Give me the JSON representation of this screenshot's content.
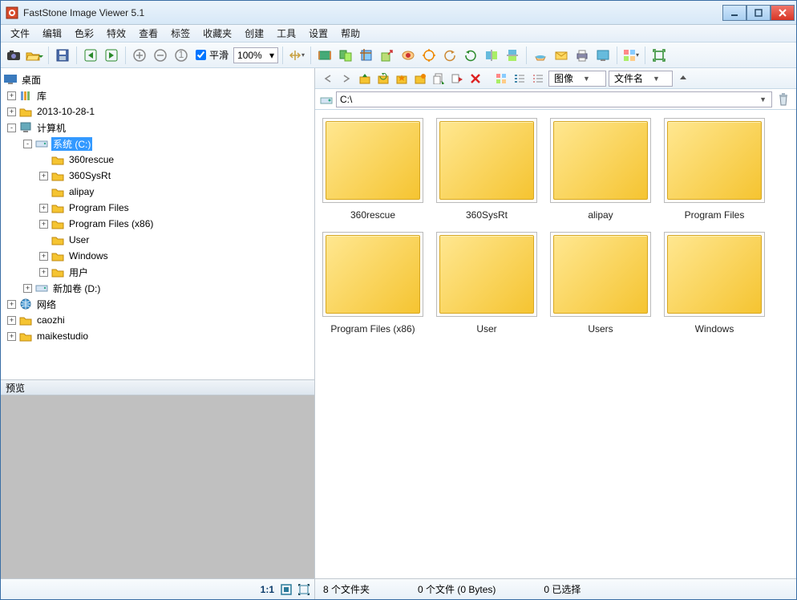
{
  "window": {
    "title": "FastStone Image Viewer 5.1"
  },
  "menu": {
    "items": [
      "文件",
      "编辑",
      "色彩",
      "特效",
      "查看",
      "标签",
      "收藏夹",
      "创建",
      "工具",
      "设置",
      "帮助"
    ]
  },
  "toolbar": {
    "smooth_label": "平滑",
    "zoom_text": "100%"
  },
  "nav_toolbar": {
    "view_group_label": "图像",
    "sort_label": "文件名"
  },
  "path_bar": {
    "current_path": "C:\\"
  },
  "tree": {
    "root_label": "桌面",
    "nodes": [
      {
        "indent": 0,
        "exp": "+",
        "icon": "library-icon",
        "label": "库"
      },
      {
        "indent": 0,
        "exp": "+",
        "icon": "folder-icon",
        "label": "2013-10-28-1"
      },
      {
        "indent": 0,
        "exp": "-",
        "icon": "computer-icon",
        "label": "计算机"
      },
      {
        "indent": 1,
        "exp": "-",
        "icon": "drive-icon",
        "label": "系统 (C:)",
        "selected": true
      },
      {
        "indent": 2,
        "exp": "",
        "icon": "folder-icon",
        "label": "360rescue"
      },
      {
        "indent": 2,
        "exp": "+",
        "icon": "folder-icon",
        "label": "360SysRt"
      },
      {
        "indent": 2,
        "exp": "",
        "icon": "folder-icon",
        "label": "alipay"
      },
      {
        "indent": 2,
        "exp": "+",
        "icon": "folder-icon",
        "label": "Program Files"
      },
      {
        "indent": 2,
        "exp": "+",
        "icon": "folder-icon",
        "label": "Program Files (x86)"
      },
      {
        "indent": 2,
        "exp": "",
        "icon": "folder-icon",
        "label": "User"
      },
      {
        "indent": 2,
        "exp": "+",
        "icon": "folder-icon",
        "label": "Windows"
      },
      {
        "indent": 2,
        "exp": "+",
        "icon": "folder-icon",
        "label": "用户"
      },
      {
        "indent": 1,
        "exp": "+",
        "icon": "drive-icon",
        "label": "新加卷 (D:)"
      },
      {
        "indent": 0,
        "exp": "+",
        "icon": "network-icon",
        "label": "网络"
      },
      {
        "indent": 0,
        "exp": "+",
        "icon": "folder-icon",
        "label": "caozhi"
      },
      {
        "indent": 0,
        "exp": "+",
        "icon": "folder-icon",
        "label": "maikestudio"
      }
    ]
  },
  "preview": {
    "header": "预览",
    "ratio": "1:1"
  },
  "thumbs": [
    {
      "label": "360rescue"
    },
    {
      "label": "360SysRt"
    },
    {
      "label": "alipay"
    },
    {
      "label": "Program Files"
    },
    {
      "label": "Program Files (x86)"
    },
    {
      "label": "User"
    },
    {
      "label": "Users"
    },
    {
      "label": "Windows"
    }
  ],
  "status": {
    "folders": "8 个文件夹",
    "files": "0 个文件 (0 Bytes)",
    "selected": "0 已选择"
  }
}
